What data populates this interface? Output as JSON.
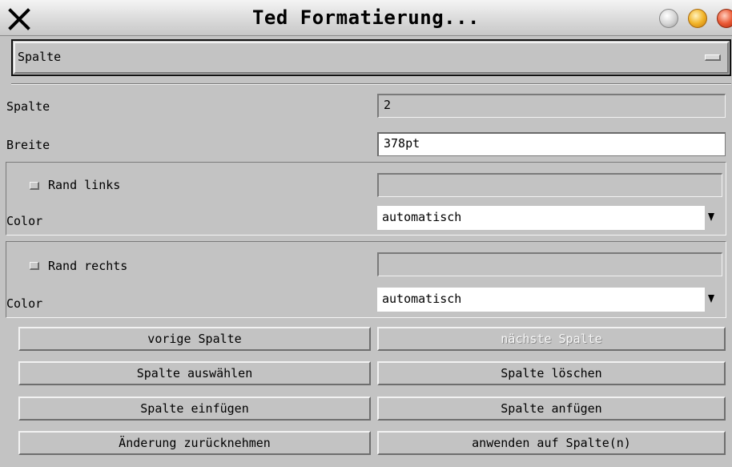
{
  "window": {
    "title": "Ted Formatierung..."
  },
  "section_menu": {
    "selected": "Spalte"
  },
  "column": {
    "label": "Spalte",
    "value": "2"
  },
  "width": {
    "label": "Breite",
    "value": "378pt"
  },
  "left_border": {
    "checkbox_label": "Rand links",
    "value": "",
    "color_label": "Color",
    "color_value": "automatisch"
  },
  "right_border": {
    "checkbox_label": "Rand rechts",
    "value": "",
    "color_label": "Color",
    "color_value": "automatisch"
  },
  "buttons": {
    "previous": "vorige Spalte",
    "next": "nächste Spalte",
    "select": "Spalte auswählen",
    "delete": "Spalte löschen",
    "insert": "Spalte einfügen",
    "append": "Spalte anfügen",
    "revert": "Änderung zurücknehmen",
    "apply": "anwenden auf Spalte(n)"
  },
  "icons": {
    "close": "close-x-icon",
    "window_controls": [
      "minimize-orb-icon",
      "maximize-orb-icon",
      "close-orb-icon"
    ],
    "combo_arrow": "triangle-down-icon",
    "option_menu": "option-menu-indicator-icon"
  },
  "colors": {
    "background": "#c3c3c3",
    "field": "#ffffff",
    "orb_yellow": "#f2b52a",
    "orb_red": "#ea5a36"
  }
}
